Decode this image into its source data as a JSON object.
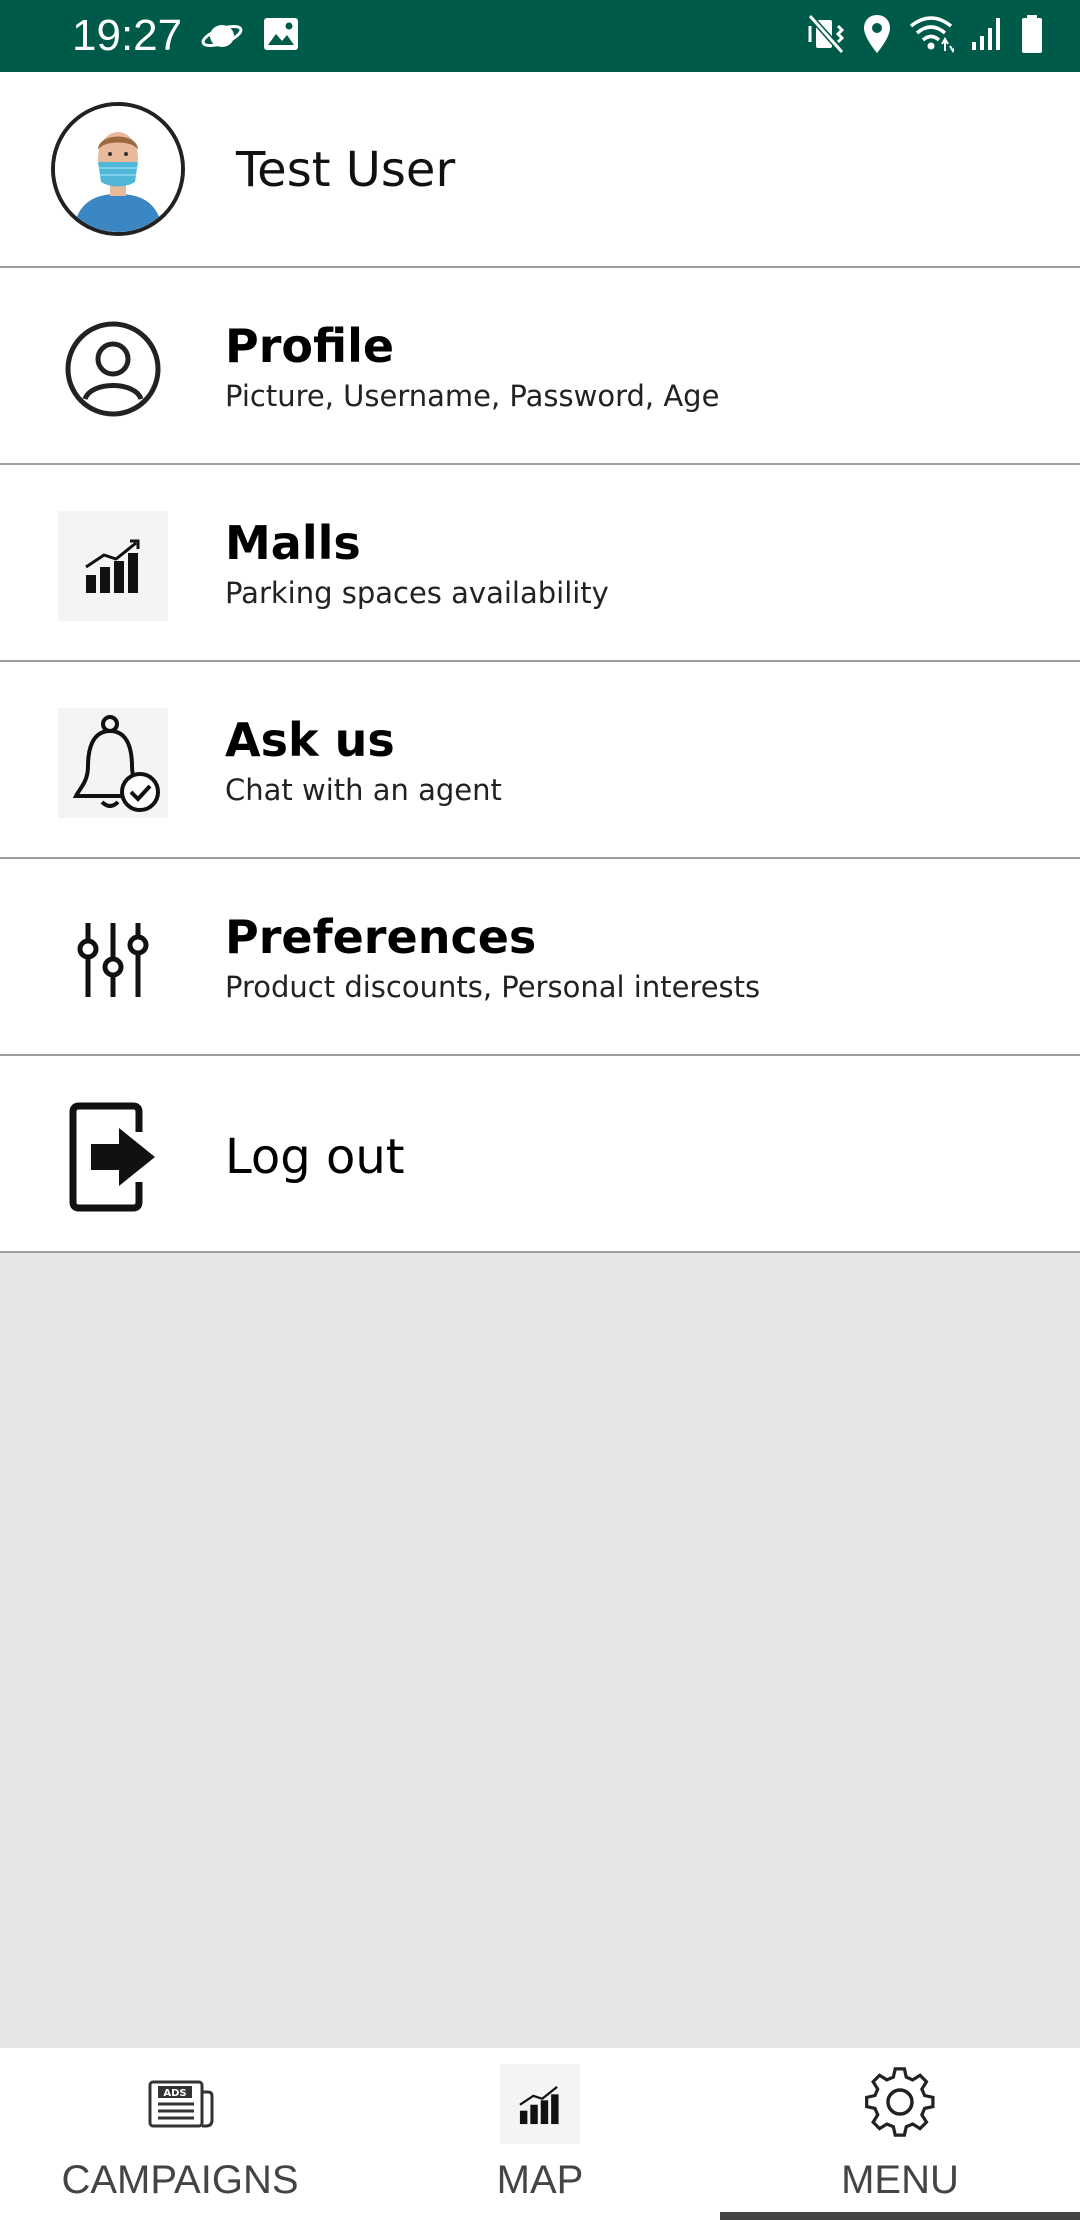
{
  "status_bar": {
    "time": "19:27",
    "left_icons": [
      "saturn-icon",
      "image-icon"
    ],
    "right_icons": [
      "mute-vibrate-icon",
      "location-icon",
      "wifi-icon",
      "signal-icon",
      "battery-icon"
    ],
    "bg_color": "#005a4a"
  },
  "user": {
    "name": "Test User"
  },
  "menu": {
    "items": [
      {
        "title": "Profile",
        "subtitle": "Picture, Username, Password, Age",
        "icon": "user-circle-icon"
      },
      {
        "title": "Malls",
        "subtitle": "Parking spaces availability",
        "icon": "bar-chart-icon"
      },
      {
        "title": "Ask us",
        "subtitle": "Chat with an agent",
        "icon": "bell-check-icon"
      },
      {
        "title": "Preferences",
        "subtitle": "Product discounts, Personal interests",
        "icon": "sliders-icon"
      }
    ],
    "logout_label": "Log out",
    "logout_icon": "logout-icon"
  },
  "bottom_nav": {
    "tabs": [
      {
        "label": "CAMPAIGNS",
        "icon": "ads-newspaper-icon"
      },
      {
        "label": "MAP",
        "icon": "bar-chart-icon"
      },
      {
        "label": "MENU",
        "icon": "gear-icon"
      }
    ],
    "active_tab": "MENU"
  }
}
